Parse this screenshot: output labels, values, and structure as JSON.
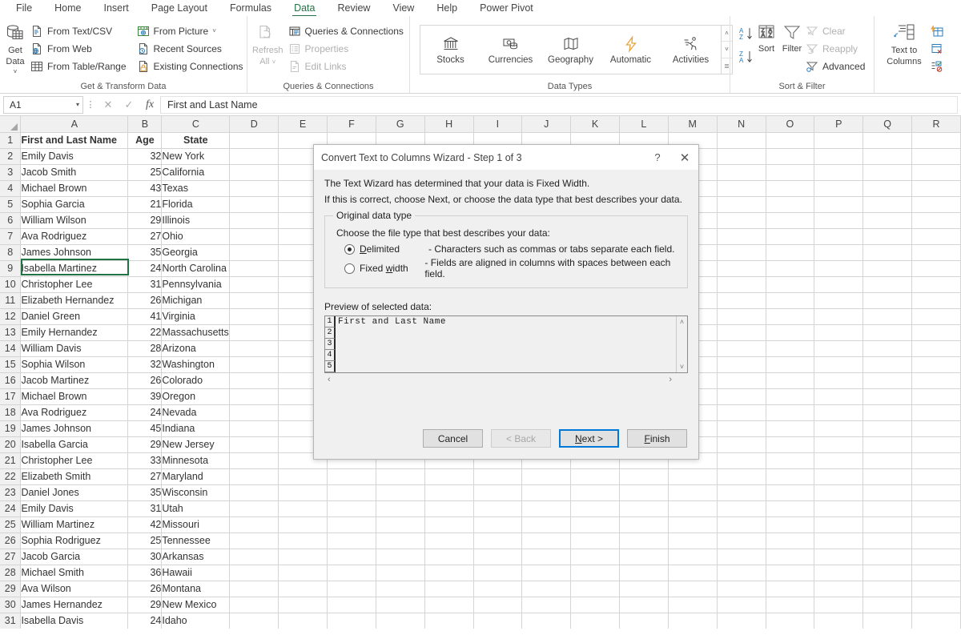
{
  "ribbon": {
    "tabs": [
      {
        "label": "File",
        "active": false
      },
      {
        "label": "Home",
        "active": false
      },
      {
        "label": "Insert",
        "active": false
      },
      {
        "label": "Page Layout",
        "active": false
      },
      {
        "label": "Formulas",
        "active": false
      },
      {
        "label": "Data",
        "active": true
      },
      {
        "label": "Review",
        "active": false
      },
      {
        "label": "View",
        "active": false
      },
      {
        "label": "Help",
        "active": false
      },
      {
        "label": "Power Pivot",
        "active": false
      }
    ],
    "accent_color": "#217346",
    "groups": {
      "get_transform": {
        "label": "Get & Transform Data",
        "get_data": {
          "line1": "Get",
          "line2": "Data",
          "caret": "˅"
        },
        "items_col1": [
          {
            "label": "From Text/CSV",
            "icon": "file-text-icon"
          },
          {
            "label": "From Web",
            "icon": "globe-icon"
          },
          {
            "label": "From Table/Range",
            "icon": "table-icon"
          }
        ],
        "items_col2": [
          {
            "label": "From Picture",
            "icon": "picture-icon",
            "caret": "˅"
          },
          {
            "label": "Recent Sources",
            "icon": "clock-icon"
          },
          {
            "label": "Existing Connections",
            "icon": "link-icon"
          }
        ]
      },
      "queries": {
        "label": "Queries & Connections",
        "refresh": {
          "line1": "Refresh",
          "line2": "All",
          "caret": "˅"
        },
        "items": [
          {
            "label": "Queries & Connections",
            "icon": "queries-icon",
            "disabled": false
          },
          {
            "label": "Properties",
            "icon": "properties-icon",
            "disabled": true
          },
          {
            "label": "Edit Links",
            "icon": "edit-links-icon",
            "disabled": true
          }
        ]
      },
      "data_types": {
        "label": "Data Types",
        "items": [
          {
            "label": "Stocks",
            "icon": "bank-icon"
          },
          {
            "label": "Currencies",
            "icon": "currency-icon"
          },
          {
            "label": "Geography",
            "icon": "map-icon"
          },
          {
            "label": "Automatic",
            "icon": "lightning-icon"
          },
          {
            "label": "Activities",
            "icon": "runner-icon"
          }
        ],
        "scroll": {
          "up": "˄",
          "down": "˅",
          "more": "≣"
        }
      },
      "sort_filter": {
        "label": "Sort & Filter",
        "sort_asc": "sort-ascending-icon",
        "sort_desc": "sort-descending-icon",
        "sort": {
          "label": "Sort",
          "icon": "sort-icon"
        },
        "filter": {
          "label": "Filter",
          "icon": "funnel-icon"
        },
        "items": [
          {
            "label": "Clear",
            "icon": "clear-filter-icon",
            "disabled": true
          },
          {
            "label": "Reapply",
            "icon": "reapply-icon",
            "disabled": true
          },
          {
            "label": "Advanced",
            "icon": "advanced-filter-icon",
            "disabled": false
          }
        ]
      },
      "data_tools": {
        "text_to_columns": {
          "line1": "Text to",
          "line2": "Columns",
          "icon": "text-to-columns-icon"
        },
        "items": [
          {
            "icon": "flash-fill-icon"
          },
          {
            "icon": "remove-duplicates-icon"
          },
          {
            "icon": "data-validation-icon"
          }
        ]
      }
    }
  },
  "formula_bar": {
    "name_box": "A1",
    "name_box_caret": "▾",
    "cancel": "✕",
    "confirm": "✓",
    "fx": "fx",
    "value": "First and Last Name"
  },
  "grid": {
    "columns": [
      "A",
      "B",
      "C",
      "D",
      "E",
      "F",
      "G",
      "H",
      "I",
      "J",
      "K",
      "L",
      "M",
      "N",
      "O",
      "P",
      "Q",
      "R"
    ],
    "headers": [
      "First and Last Name",
      "Age",
      "State"
    ],
    "rows": [
      {
        "n": 2,
        "name": "Emily Davis",
        "age": "32",
        "state": "New York"
      },
      {
        "n": 3,
        "name": "Jacob Smith",
        "age": "25",
        "state": "California"
      },
      {
        "n": 4,
        "name": "Michael Brown",
        "age": "43",
        "state": "Texas"
      },
      {
        "n": 5,
        "name": "Sophia Garcia",
        "age": "21",
        "state": "Florida"
      },
      {
        "n": 6,
        "name": "William Wilson",
        "age": "29",
        "state": "Illinois"
      },
      {
        "n": 7,
        "name": "Ava Rodriguez",
        "age": "27",
        "state": "Ohio"
      },
      {
        "n": 8,
        "name": "James Johnson",
        "age": "35",
        "state": "Georgia"
      },
      {
        "n": 9,
        "name": "Isabella Martinez",
        "age": "24",
        "state": "North Carolina"
      },
      {
        "n": 10,
        "name": "Christopher Lee",
        "age": "31",
        "state": "Pennsylvania"
      },
      {
        "n": 11,
        "name": "Elizabeth Hernandez",
        "age": "26",
        "state": "Michigan"
      },
      {
        "n": 12,
        "name": "Daniel Green",
        "age": "41",
        "state": "Virginia"
      },
      {
        "n": 13,
        "name": "Emily Hernandez",
        "age": "22",
        "state": "Massachusetts"
      },
      {
        "n": 14,
        "name": "William Davis",
        "age": "28",
        "state": "Arizona"
      },
      {
        "n": 15,
        "name": "Sophia Wilson",
        "age": "32",
        "state": "Washington"
      },
      {
        "n": 16,
        "name": "Jacob Martinez",
        "age": "26",
        "state": "Colorado"
      },
      {
        "n": 17,
        "name": "Michael Brown",
        "age": "39",
        "state": "Oregon"
      },
      {
        "n": 18,
        "name": "Ava Rodriguez",
        "age": "24",
        "state": "Nevada"
      },
      {
        "n": 19,
        "name": "James Johnson",
        "age": "45",
        "state": "Indiana"
      },
      {
        "n": 20,
        "name": "Isabella Garcia",
        "age": "29",
        "state": "New Jersey"
      },
      {
        "n": 21,
        "name": "Christopher Lee",
        "age": "33",
        "state": "Minnesota"
      },
      {
        "n": 22,
        "name": "Elizabeth Smith",
        "age": "27",
        "state": "Maryland"
      },
      {
        "n": 23,
        "name": "Daniel Jones",
        "age": "35",
        "state": "Wisconsin"
      },
      {
        "n": 24,
        "name": "Emily Davis",
        "age": "31",
        "state": "Utah"
      },
      {
        "n": 25,
        "name": "William Martinez",
        "age": "42",
        "state": "Missouri"
      },
      {
        "n": 26,
        "name": "Sophia Rodriguez",
        "age": "25",
        "state": "Tennessee"
      },
      {
        "n": 27,
        "name": "Jacob Garcia",
        "age": "30",
        "state": "Arkansas"
      },
      {
        "n": 28,
        "name": "Michael Smith",
        "age": "36",
        "state": "Hawaii"
      },
      {
        "n": 29,
        "name": "Ava Wilson",
        "age": "26",
        "state": "Montana"
      },
      {
        "n": 30,
        "name": "James Hernandez",
        "age": "29",
        "state": "New Mexico"
      },
      {
        "n": 31,
        "name": "Isabella Davis",
        "age": "24",
        "state": "Idaho"
      }
    ],
    "selected_cell": "A1"
  },
  "dialog": {
    "title": "Convert Text to Columns Wizard - Step 1 of 3",
    "help_label": "?",
    "close_label": "✕",
    "line1": "The Text Wizard has determined that your data is Fixed Width.",
    "line2": "If this is correct, choose Next, or choose the data type that best describes your data.",
    "group_legend": "Original data type",
    "group_intro": "Choose the file type that best describes your data:",
    "options": [
      {
        "label": "Delimited",
        "underline_index": 0,
        "description": "- Characters such as commas or tabs separate each field.",
        "selected": true
      },
      {
        "label": "Fixed width",
        "underline_index": 6,
        "description": "- Fields are aligned in columns with spaces between each field.",
        "selected": false
      }
    ],
    "preview_label": "Preview of selected data:",
    "preview_rows": [
      {
        "n": "1",
        "text": "First and Last Name"
      },
      {
        "n": "2",
        "text": ""
      },
      {
        "n": "3",
        "text": ""
      },
      {
        "n": "4",
        "text": ""
      },
      {
        "n": "5",
        "text": ""
      }
    ],
    "scroll_up": "˄",
    "scroll_down": "˅",
    "scroll_left": "‹",
    "scroll_right": "›",
    "buttons": [
      {
        "label": "Cancel",
        "state": "normal"
      },
      {
        "label": "< Back",
        "state": "disabled"
      },
      {
        "label": "Next >",
        "state": "default"
      },
      {
        "label": "Finish",
        "state": "normal"
      }
    ],
    "default_button_color": "#0078d7"
  }
}
